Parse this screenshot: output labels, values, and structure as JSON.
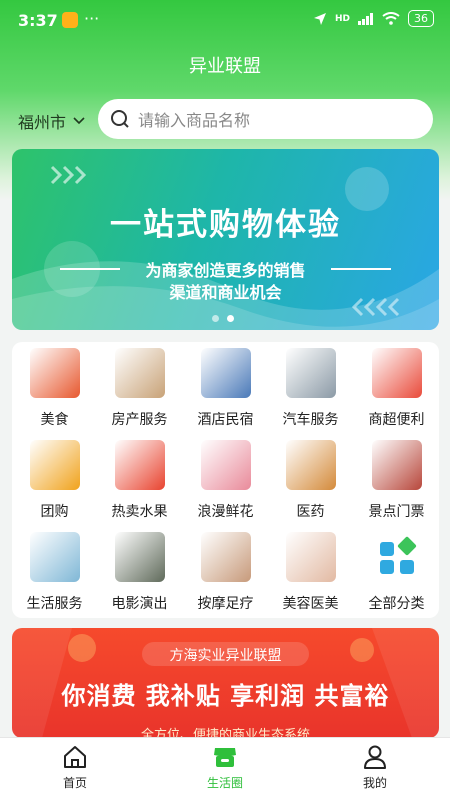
{
  "status_bar": {
    "time": "3:37",
    "dots": "···",
    "network": "HD",
    "battery": "36"
  },
  "header": {
    "title": "异业联盟"
  },
  "location": {
    "city": "福州市"
  },
  "search": {
    "placeholder": "请输入商品名称"
  },
  "banner": {
    "headline": "一站式购物体验",
    "line1": "为商家创造更多的销售",
    "line2": "渠道和商业机会"
  },
  "categories": [
    {
      "label": "美食",
      "icon": "food-image",
      "color": "#e7582f"
    },
    {
      "label": "房产服务",
      "icon": "living-room-image",
      "color": "#c8a277"
    },
    {
      "label": "酒店民宿",
      "icon": "hotel-building-image",
      "color": "#4a79b8"
    },
    {
      "label": "汽车服务",
      "icon": "car-image",
      "color": "#8b9aa6"
    },
    {
      "label": "商超便利",
      "icon": "shopping-cart-image",
      "color": "#e94a3a"
    },
    {
      "label": "团购",
      "icon": "group-buy-image",
      "color": "#f0a21c"
    },
    {
      "label": "热卖水果",
      "icon": "fruit-image",
      "color": "#e8432f"
    },
    {
      "label": "浪漫鲜花",
      "icon": "flowers-image",
      "color": "#e98a9a"
    },
    {
      "label": "医药",
      "icon": "medicine-image",
      "color": "#d48a3a"
    },
    {
      "label": "景点门票",
      "icon": "scenic-building-image",
      "color": "#b7463a"
    },
    {
      "label": "生活服务",
      "icon": "life-service-image",
      "color": "#7fb7d6"
    },
    {
      "label": "电影演出",
      "icon": "movie-image",
      "color": "#5f6a5a"
    },
    {
      "label": "按摩足疗",
      "icon": "massage-image",
      "color": "#c79a7a"
    },
    {
      "label": "美容医美",
      "icon": "beauty-image",
      "color": "#e2b9a2"
    },
    {
      "label": "全部分类",
      "icon": "grid-all-icon",
      "color": "#2fa9e0"
    }
  ],
  "promo": {
    "company": "方海实业异业联盟",
    "slogan": "你消费 我补贴 享利润 共富裕",
    "tagline": "全方位、便捷的商业生态系统"
  },
  "tabs": [
    {
      "label": "首页",
      "icon": "home-icon",
      "active": false
    },
    {
      "label": "生活圈",
      "icon": "store-icon",
      "active": true
    },
    {
      "label": "我的",
      "icon": "profile-icon",
      "active": false
    }
  ],
  "colors": {
    "brand_green": "#34c840",
    "promo_red": "#f64a2c"
  }
}
